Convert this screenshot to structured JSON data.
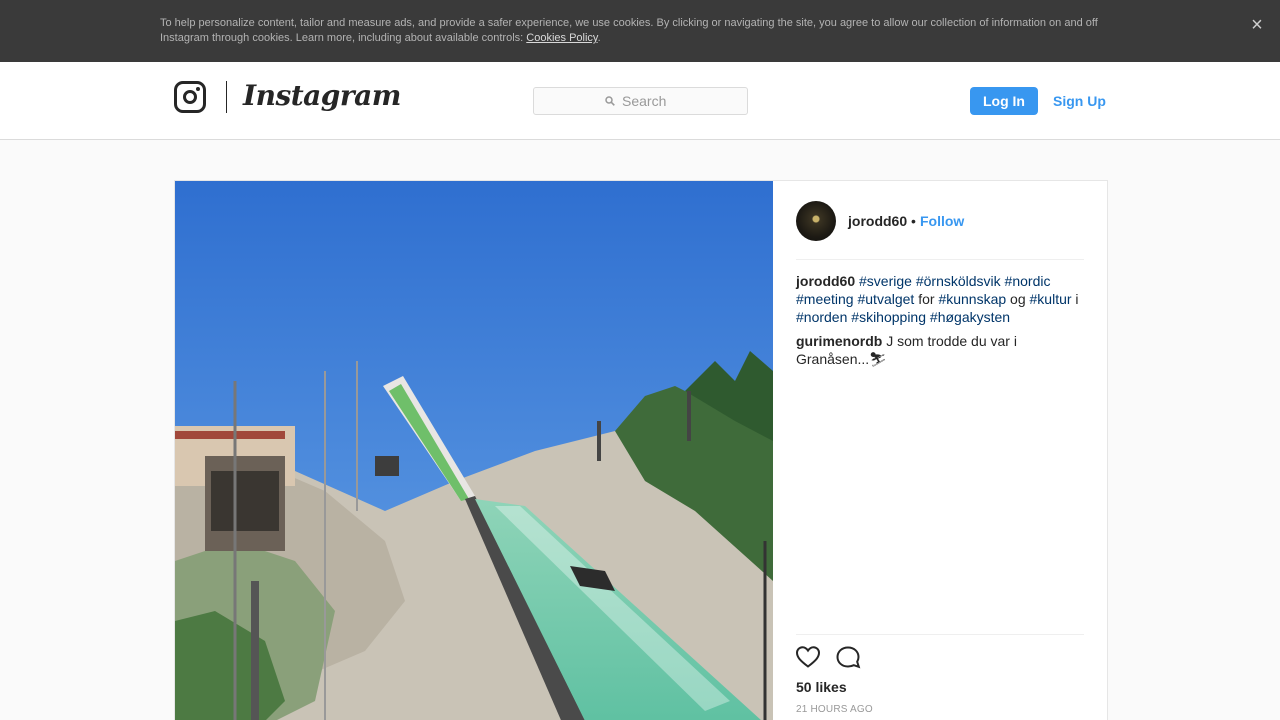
{
  "cookie_banner": {
    "text": "To help personalize content, tailor and measure ads, and provide a safer experience, we use cookies. By clicking or navigating the site, you agree to allow our collection of information on and off Instagram through cookies. Learn more, including about available controls: ",
    "link": "Cookies Policy",
    "period": ".",
    "close_icon": "close-icon",
    "close_glyph": "×"
  },
  "header": {
    "logo_icon": "camera-icon",
    "wordmark": "Instagram",
    "search": {
      "icon": "search-icon",
      "placeholder": "Search"
    },
    "login_label": "Log In",
    "signup_label": "Sign Up",
    "accent": "#3897f0"
  },
  "post": {
    "author": "jorodd60",
    "separator": "•",
    "follow_label": "Follow",
    "caption": {
      "user": "jorodd60",
      "parts": [
        {
          "t": "tag",
          "v": "#sverige"
        },
        {
          "t": "txt",
          "v": " "
        },
        {
          "t": "tag",
          "v": "#örnsköldsvik"
        },
        {
          "t": "txt",
          "v": " "
        },
        {
          "t": "tag",
          "v": "#nordic"
        },
        {
          "t": "txt",
          "v": " "
        },
        {
          "t": "tag",
          "v": "#meeting"
        },
        {
          "t": "txt",
          "v": " "
        },
        {
          "t": "tag",
          "v": "#utvalget"
        },
        {
          "t": "txt",
          "v": " for "
        },
        {
          "t": "tag",
          "v": "#kunnskap"
        },
        {
          "t": "txt",
          "v": " og "
        },
        {
          "t": "tag",
          "v": "#kultur"
        },
        {
          "t": "txt",
          "v": " i "
        },
        {
          "t": "tag",
          "v": "#norden"
        },
        {
          "t": "txt",
          "v": " "
        },
        {
          "t": "tag",
          "v": "#skihopping"
        },
        {
          "t": "txt",
          "v": " "
        },
        {
          "t": "tag",
          "v": "#høgakysten"
        }
      ]
    },
    "comment": {
      "user": "gurimenordb",
      "text": "J som trodde du var i Granåsen...⛷"
    },
    "actions": {
      "like_icon": "heart-icon",
      "comment_icon": "comment-icon"
    },
    "likes": "50 likes",
    "time": "21 HOURS AGO",
    "photo_description_icon": "ski-jump-photo"
  }
}
